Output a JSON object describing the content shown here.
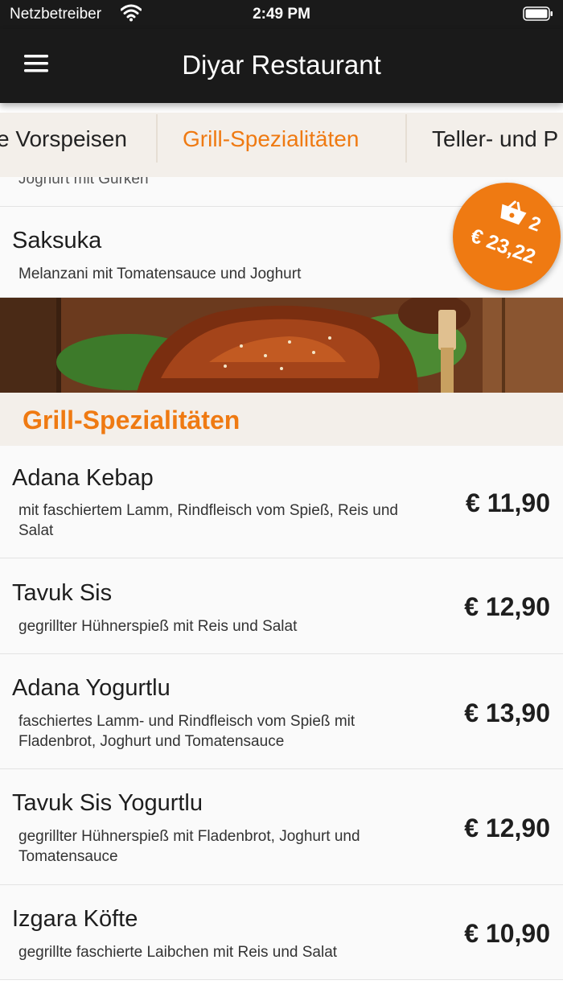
{
  "status_bar": {
    "carrier": "Netzbetreiber",
    "time": "2:49 PM"
  },
  "header": {
    "title": "Diyar Restaurant"
  },
  "tabs": [
    {
      "label": "e Vorspeisen",
      "active": false
    },
    {
      "label": "Grill-Spezialitäten",
      "active": true
    },
    {
      "label": "Teller- und P",
      "active": false
    }
  ],
  "previous_section": {
    "partial_desc": "Joghurt mit Gurken",
    "item": {
      "name": "Saksuka",
      "desc": "Melanzani mit Tomatensauce und Joghurt"
    }
  },
  "section": {
    "title": "Grill-Spezialitäten"
  },
  "items": [
    {
      "name": "Adana Kebap",
      "desc": "mit faschiertem Lamm, Rindfleisch vom Spieß, Reis und Salat",
      "price": "€ 11,90"
    },
    {
      "name": "Tavuk Sis",
      "desc": "gegrillter Hühnerspieß mit Reis und Salat",
      "price": "€ 12,90"
    },
    {
      "name": "Adana Yogurtlu",
      "desc": "faschiertes Lamm- und Rindfleisch vom Spieß mit Fladenbrot, Joghurt und Tomatensauce",
      "price": "€ 13,90"
    },
    {
      "name": "Tavuk Sis Yogurtlu",
      "desc": "gegrillter Hühnerspieß mit Fladenbrot, Joghurt und Tomatensauce",
      "price": "€ 12,90"
    },
    {
      "name": "Izgara Köfte",
      "desc": "gegrillte faschierte Laibchen mit Reis und Salat",
      "price": "€ 10,90"
    }
  ],
  "cart": {
    "count": "2",
    "total": "€ 23,22"
  },
  "colors": {
    "accent": "#ef7a12",
    "header_bg": "#1a1a1a",
    "tab_bg": "#f3efea"
  }
}
